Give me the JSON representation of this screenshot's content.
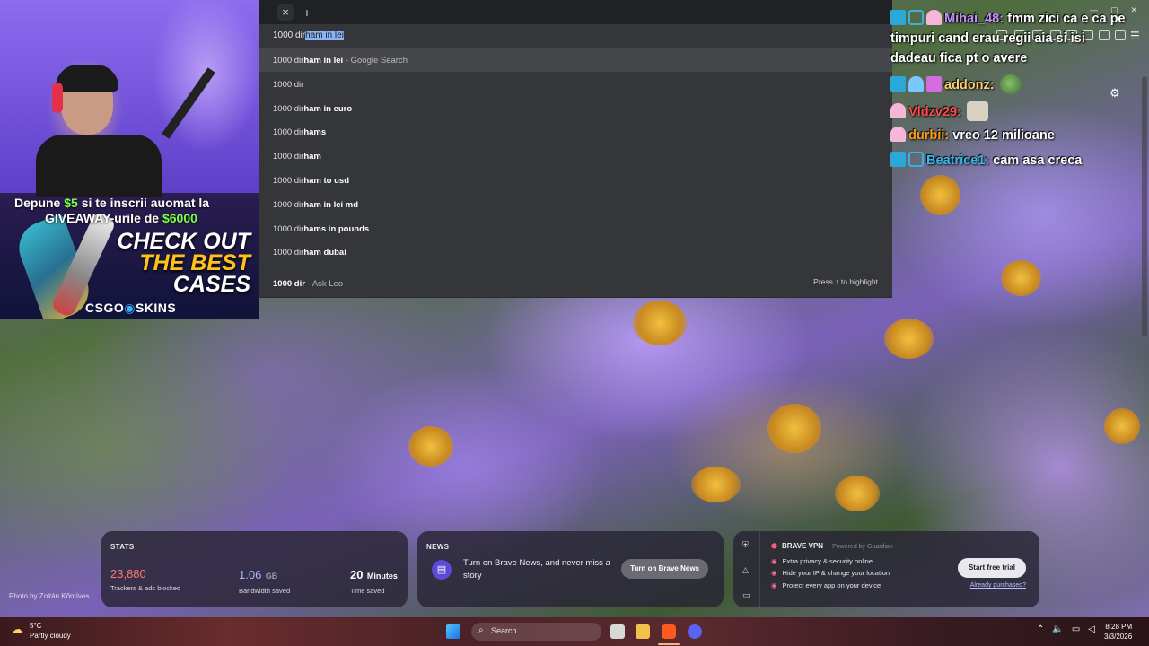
{
  "browser": {
    "tab_close": "×",
    "tab_new": "+",
    "window_controls": [
      "—",
      "▢",
      "✕"
    ]
  },
  "omnibox": {
    "typed": "1000 dir",
    "autocomplete": "ham in lei",
    "suggestions": [
      {
        "prefix": "1000 dir",
        "bold": "ham in lei",
        "hint": "- Google Search"
      },
      {
        "prefix": "1000 dir",
        "bold": "",
        "hint": ""
      },
      {
        "prefix": "1000 dir",
        "bold": "ham in euro",
        "hint": ""
      },
      {
        "prefix": "1000 dir",
        "bold": "hams",
        "hint": ""
      },
      {
        "prefix": "1000 dir",
        "bold": "ham",
        "hint": ""
      },
      {
        "prefix": "1000 dir",
        "bold": "ham to usd",
        "hint": ""
      },
      {
        "prefix": "1000 dir",
        "bold": "ham in lei md",
        "hint": ""
      },
      {
        "prefix": "1000 dir",
        "bold": "hams in pounds",
        "hint": ""
      },
      {
        "prefix": "1000 dir",
        "bold": "ham dubai",
        "hint": ""
      }
    ],
    "leo": {
      "bold": "1000 dir",
      "hint": "- Ask Leo"
    },
    "press_hint": "Press ↑ to highlight"
  },
  "webcam": {
    "promo_line1_a": "Depune ",
    "promo_line1_amount": "$5",
    "promo_line1_b": " si te inscrii auomat la",
    "promo_line2_a": "GIVEAWAY-urile de ",
    "promo_line2_amount": "$6000",
    "check_out_1": "CHECK OUT",
    "check_out_2": "THE BEST",
    "check_out_3": "CASES",
    "brand_a": "CSGO",
    "brand_b": "SKINS"
  },
  "chat": [
    {
      "user": "Mihai_48:",
      "color": "#c58cff",
      "text": "fmm zici ca e ca pe timpuri cand erau regii aia si isi dadeau fica pt o avere"
    },
    {
      "user": "addonz:",
      "color": "#ffcf6b",
      "text": ""
    },
    {
      "user": "Vldzv29:",
      "color": "#ff4a4a",
      "text": ""
    },
    {
      "user": "durbii:",
      "color": "#ff9a1a",
      "text": "vreo 12 milioane"
    },
    {
      "user": "Beatrice1:",
      "color": "#3ab6e8",
      "text": "cam asa creca"
    }
  ],
  "stats": {
    "title": "STATS",
    "trackers_value": "23,880",
    "trackers_label": "Trackers & ads blocked",
    "bandwidth_value": "1.06",
    "bandwidth_unit": "GB",
    "bandwidth_label": "Bandwidth saved",
    "time_value": "20",
    "time_unit": "Minutes",
    "time_label": "Time saved"
  },
  "news": {
    "title": "NEWS",
    "text": "Turn on Brave News, and never miss a story",
    "button": "Turn on Brave News"
  },
  "vpn": {
    "title": "BRAVE VPN",
    "powered": "Powered by Guardian",
    "features": [
      "Extra privacy & security online",
      "Hide your IP & change your location",
      "Protect every app on your device"
    ],
    "button": "Start free trial",
    "link": "Already purchased?"
  },
  "photo_credit": "Photo by Zoltán Kőmíves",
  "taskbar": {
    "temperature": "5°C",
    "weather": "Partly cloudy",
    "search": "Search",
    "time": "8:28 PM",
    "date": "3/3/2026"
  }
}
